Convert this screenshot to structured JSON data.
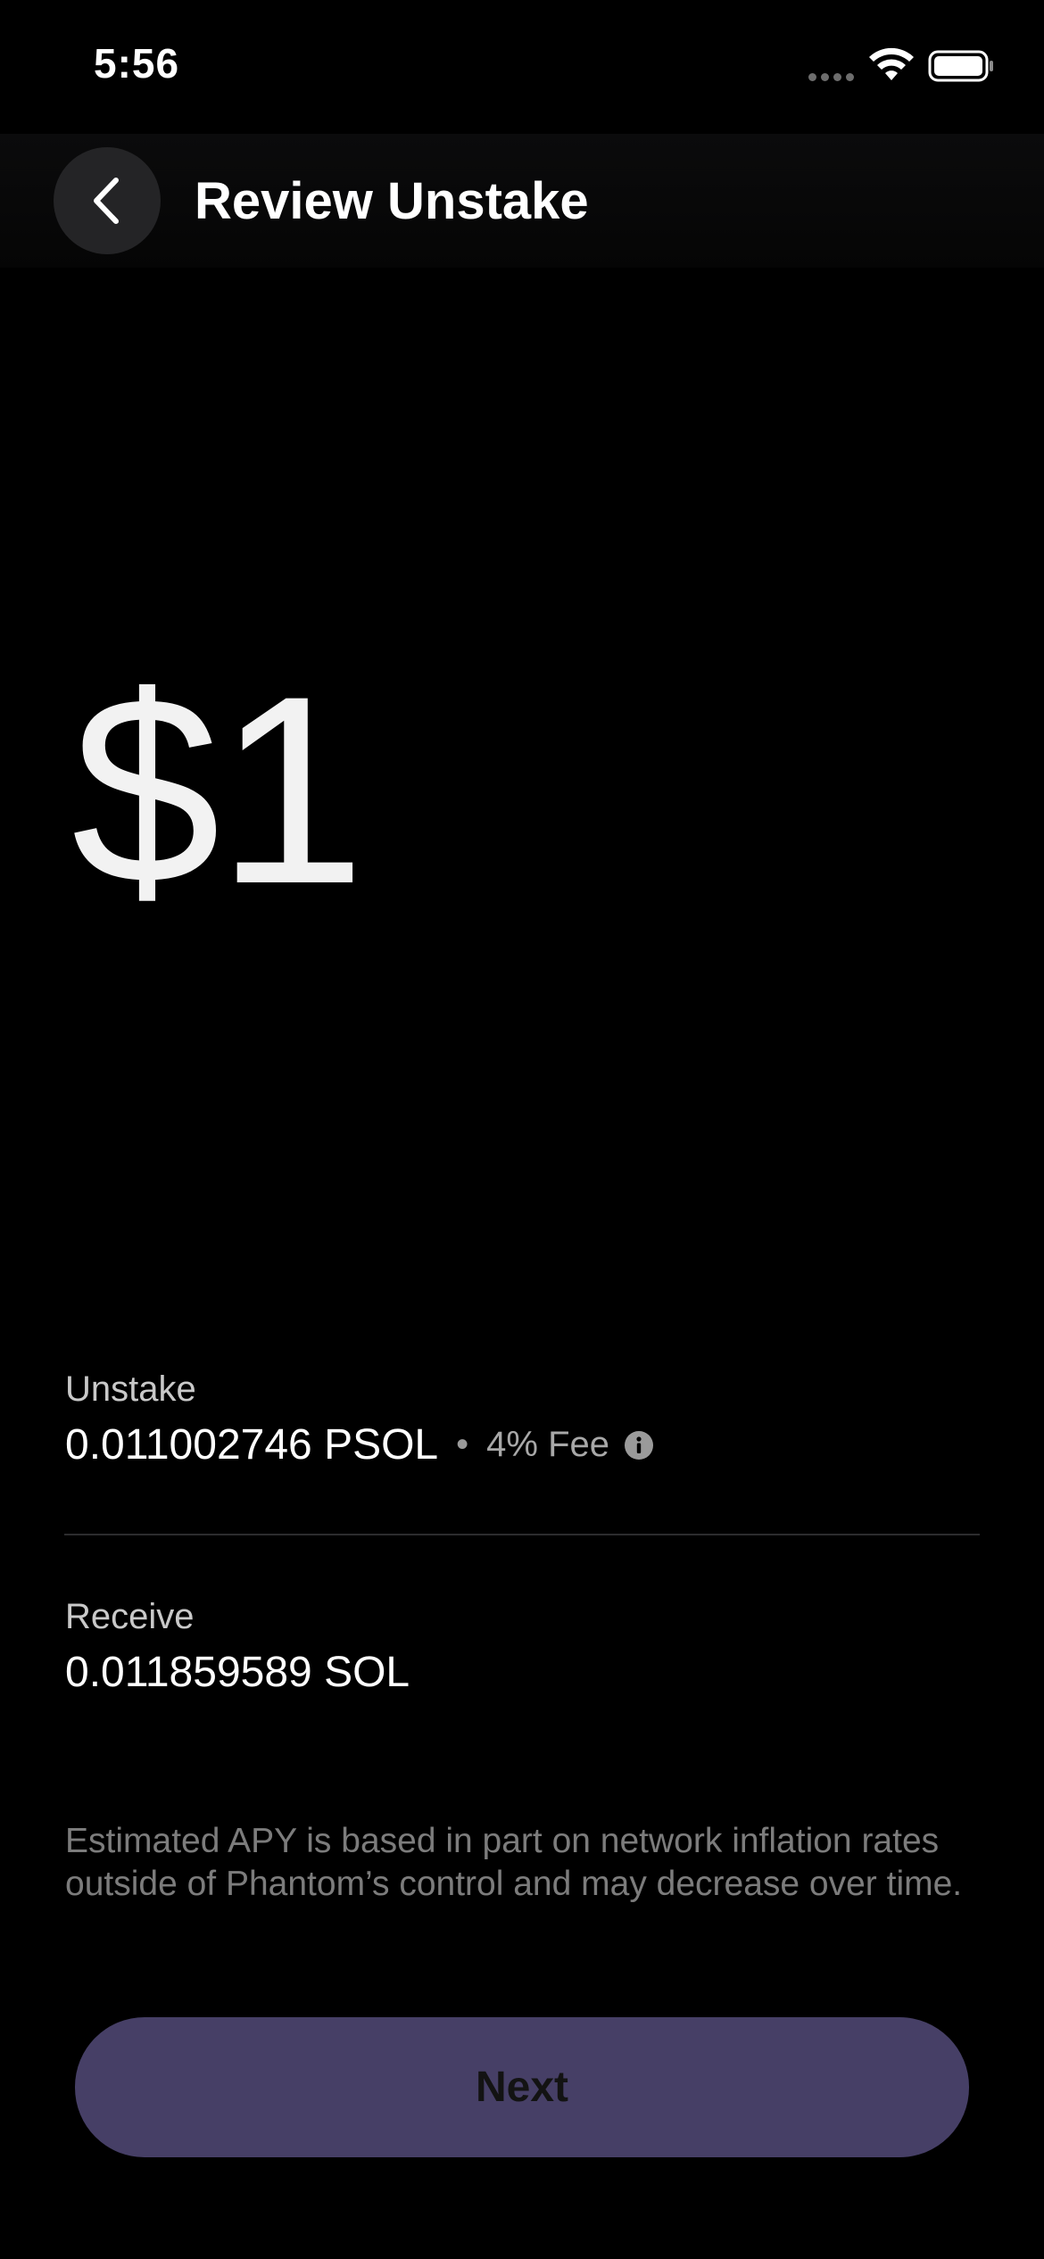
{
  "status_bar": {
    "time": "5:56"
  },
  "header": {
    "title": "Review Unstake",
    "back_icon": "chevron-left-icon"
  },
  "amount": {
    "display": "$1"
  },
  "unstake": {
    "label": "Unstake",
    "value": "0.011002746 PSOL",
    "separator": "•",
    "fee": "4% Fee",
    "fee_icon": "info-icon"
  },
  "receive": {
    "label": "Receive",
    "value": "0.011859589 SOL"
  },
  "disclaimer": "Estimated APY is based in part on network inflation rates outside of Phantom’s control and may decrease over time.",
  "next_button": {
    "label": "Next"
  },
  "colors": {
    "background": "#000000",
    "button": "#463f66",
    "button_text": "#131313",
    "muted_text": "#7c7c7c"
  }
}
